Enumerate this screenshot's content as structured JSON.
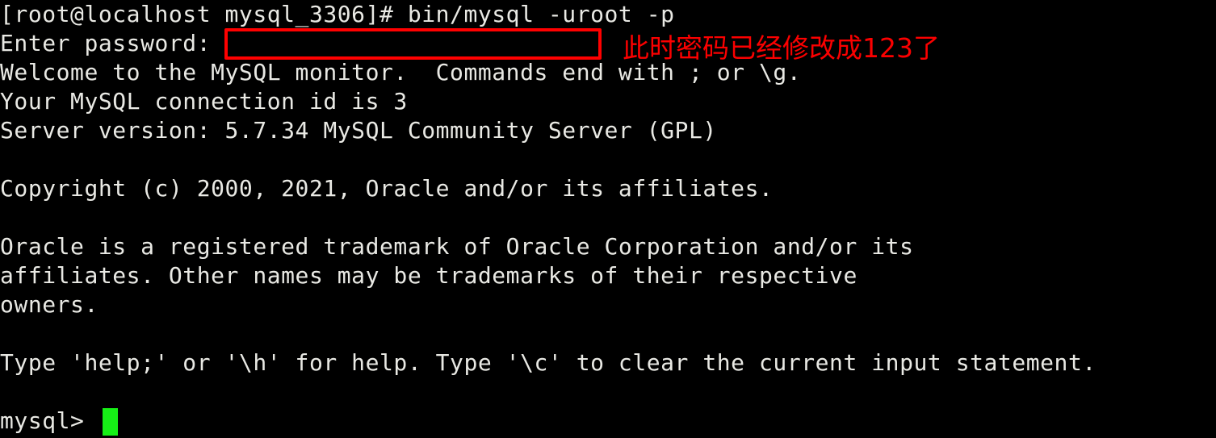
{
  "terminal": {
    "background_color": "#000000",
    "foreground_color": "#e9e9e4",
    "annotation_color": "#ff0000",
    "cursor_color": "#16f016",
    "lines": [
      {
        "id": "shell-prompt-command",
        "text": "[root@localhost mysql_3306]# bin/mysql -uroot -p"
      },
      {
        "id": "password-prompt",
        "text": "Enter password:"
      },
      {
        "id": "welcome-banner",
        "text": "Welcome to the MySQL monitor.  Commands end with ; or \\g."
      },
      {
        "id": "connection-id",
        "text": "Your MySQL connection id is 3"
      },
      {
        "id": "server-version",
        "text": "Server version: 5.7.34 MySQL Community Server (GPL)"
      },
      {
        "id": "blank-1",
        "text": ""
      },
      {
        "id": "copyright",
        "text": "Copyright (c) 2000, 2021, Oracle and/or its affiliates."
      },
      {
        "id": "blank-2",
        "text": ""
      },
      {
        "id": "trademark-line-1",
        "text": "Oracle is a registered trademark of Oracle Corporation and/or its"
      },
      {
        "id": "trademark-line-2",
        "text": "affiliates. Other names may be trademarks of their respective"
      },
      {
        "id": "trademark-line-3",
        "text": "owners."
      },
      {
        "id": "blank-3",
        "text": ""
      },
      {
        "id": "help-hint",
        "text": "Type 'help;' or '\\h' for help. Type '\\c' to clear the current input statement."
      },
      {
        "id": "blank-4",
        "text": ""
      },
      {
        "id": "mysql-prompt",
        "text": "mysql> "
      }
    ]
  },
  "annotation": {
    "text": "此时密码已经修改成123了",
    "color": "#ff0000"
  },
  "password_box": {
    "label": "password-input-highlight",
    "border_color": "#ff0000"
  }
}
